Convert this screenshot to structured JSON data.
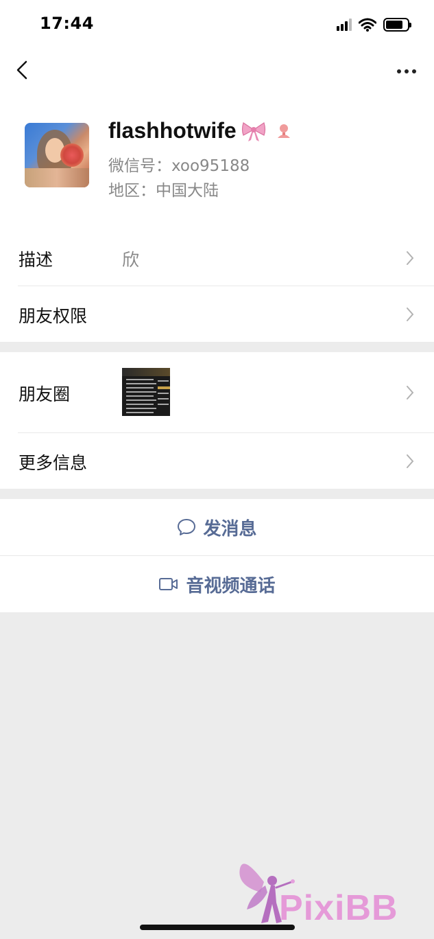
{
  "status": {
    "time": "17:44"
  },
  "profile": {
    "nickname": "flashhotwife",
    "wechat_id": "微信号：xoo95188",
    "region": "地区：中国大陆"
  },
  "rows": {
    "description": {
      "label": "描述",
      "value": "欣"
    },
    "permissions": {
      "label": "朋友权限"
    },
    "moments": {
      "label": "朋友圈"
    },
    "more_info": {
      "label": "更多信息"
    }
  },
  "actions": {
    "message": "发消息",
    "video_call": "音视频通话"
  },
  "watermark": {
    "text": "PixiBB"
  },
  "colors": {
    "link_blue": "#576b95",
    "background": "#ececec",
    "watermark_pink": "#e59ad8"
  }
}
